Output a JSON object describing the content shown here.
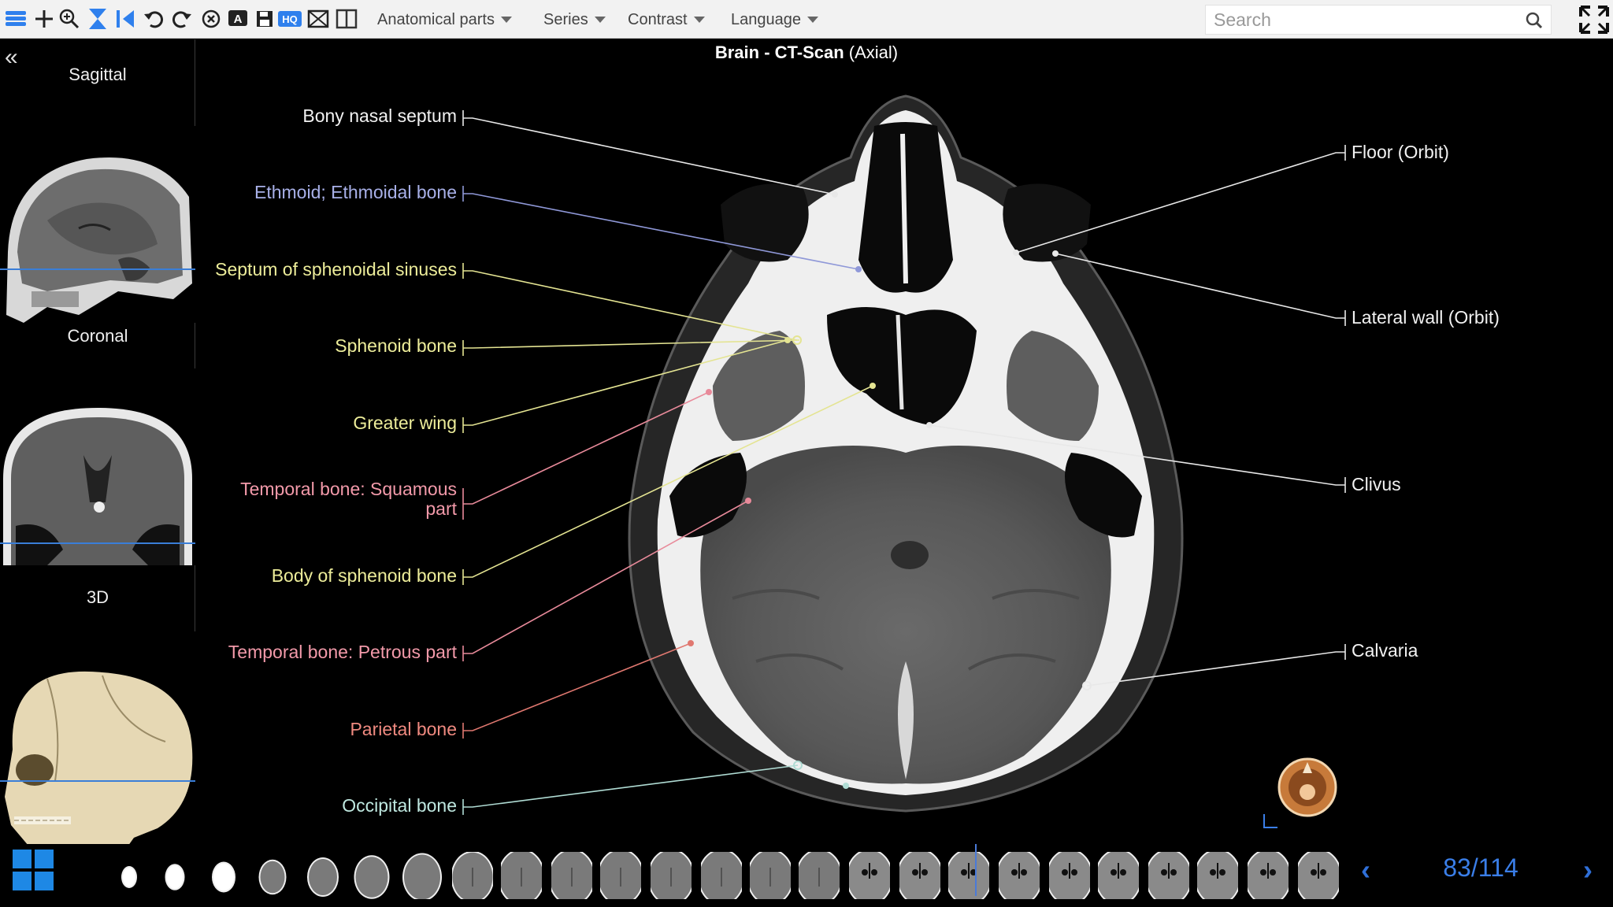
{
  "toolbar": {
    "menus": [
      {
        "label": "Anatomical parts"
      },
      {
        "label": "Series"
      },
      {
        "label": "Contrast"
      },
      {
        "label": "Language"
      }
    ],
    "search_placeholder": "Search",
    "hq_label": "HQ",
    "annot_label": "A"
  },
  "sidebar": {
    "views": [
      {
        "label": "Sagittal"
      },
      {
        "label": "Coronal"
      },
      {
        "label": "3D"
      }
    ]
  },
  "title": {
    "main": "Brain - CT-Scan",
    "sub": "(Axial)"
  },
  "labels": {
    "left": [
      {
        "text": "Bony nasal septum",
        "color": "#f2f2f2"
      },
      {
        "text": "Ethmoid; Ethmoidal bone",
        "color": "#a8b0e8"
      },
      {
        "text": "Septum of sphenoidal sinuses",
        "color": "#eded9a"
      },
      {
        "text": "Sphenoid bone",
        "color": "#eded9a"
      },
      {
        "text": "Greater wing",
        "color": "#eded9a"
      },
      {
        "text": "Temporal bone: Squamous",
        "text2": "part",
        "color": "#f39aaa"
      },
      {
        "text": "Body of sphenoid bone",
        "color": "#eded9a"
      },
      {
        "text": "Temporal bone: Petrous part",
        "color": "#f39aaa"
      },
      {
        "text": "Parietal bone",
        "color": "#f08a80"
      },
      {
        "text": "Occipital bone",
        "color": "#bfe8e0"
      }
    ],
    "right": [
      {
        "text": "Floor (Orbit)",
        "color": "#f2f2f2"
      },
      {
        "text": "Lateral wall (Orbit)",
        "color": "#f2f2f2"
      },
      {
        "text": "Clivus",
        "color": "#f2f2f2"
      },
      {
        "text": "Calvaria",
        "color": "#f2f2f2"
      }
    ]
  },
  "slices": {
    "current": 83,
    "total": 114,
    "counter_text": "83/114"
  },
  "colors": {
    "accent": "#1e88e5",
    "counter": "#3a7ee8"
  }
}
